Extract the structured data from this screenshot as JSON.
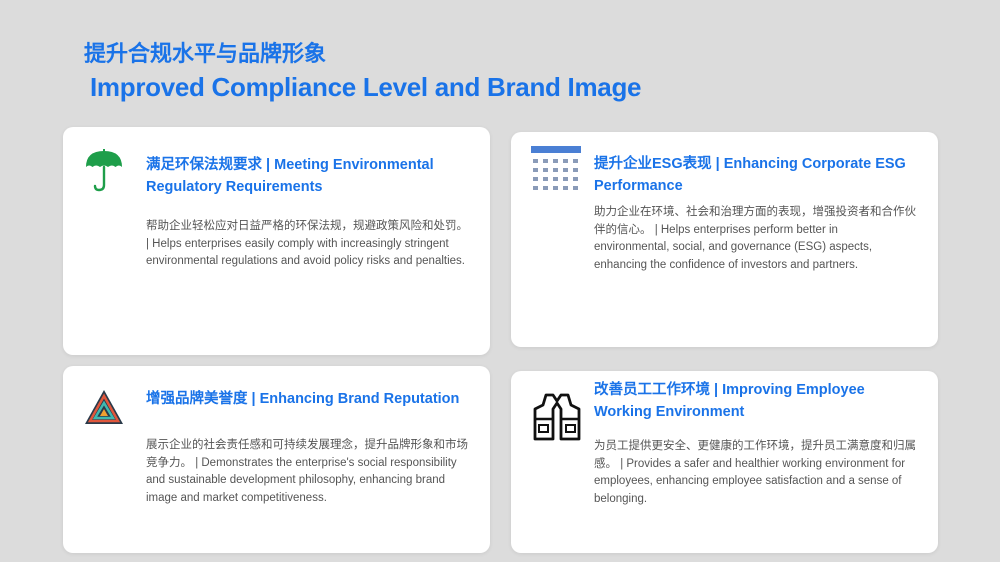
{
  "header": {
    "title_zh": "提升合规水平与品牌形象",
    "title_en": "Improved Compliance Level and Brand Image"
  },
  "colors": {
    "accent": "#1a73e8",
    "background": "#dcdcdc",
    "card": "#ffffff",
    "body_text": "#555555"
  },
  "cards": [
    {
      "icon": "umbrella-icon",
      "title": "满足环保法规要求 | Meeting Environmental Regulatory Requirements",
      "body": "帮助企业轻松应对日益严格的环保法规，规避政策风险和处罚。 | Helps enterprises easily comply with increasingly stringent environmental regulations and avoid policy risks and penalties."
    },
    {
      "icon": "esg-report-icon",
      "title": "提升企业ESG表现 | Enhancing Corporate ESG Performance",
      "body": "助力企业在环境、社会和治理方面的表现，增强投资者和合作伙伴的信心。 | Helps enterprises perform better in environmental, social, and governance (ESG) aspects, enhancing the confidence of investors and partners."
    },
    {
      "icon": "triangle-logo-icon",
      "title": "增强品牌美誉度 | Enhancing Brand Reputation",
      "body": "展示企业的社会责任感和可持续发展理念，提升品牌形象和市场竞争力。 | Demonstrates the enterprise's social responsibility and sustainable development philosophy, enhancing brand image and market competitiveness."
    },
    {
      "icon": "safety-vest-icon",
      "title": "改善员工工作环境 | Improving Employee Working Environment",
      "body": "为员工提供更安全、更健康的工作环境，提升员工满意度和归属感。 | Provides a safer and healthier working environment for employees, enhancing employee satisfaction and a sense of belonging."
    }
  ]
}
